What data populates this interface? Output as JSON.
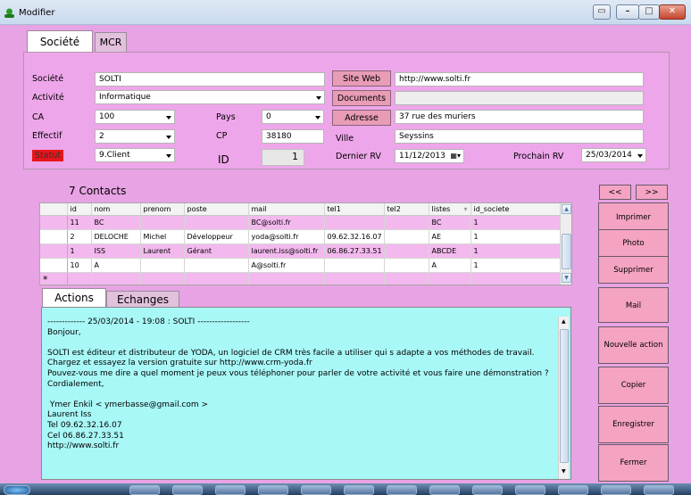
{
  "window": {
    "title": "Modifier"
  },
  "tabs_top": [
    "Société",
    "MCR"
  ],
  "societe": {
    "societe_label": "Société",
    "societe_value": "SOLTI",
    "activite_label": "Activité",
    "activite_value": "Informatique",
    "ca_label": "CA",
    "ca_value": "100",
    "effectif_label": "Effectif",
    "effectif_value": "2",
    "statut_label": "Statut",
    "statut_value": "9.Client",
    "pays_label": "Pays",
    "pays_value": "0",
    "cp_label": "CP",
    "cp_value": "38180",
    "id_label": "ID",
    "id_value": "1",
    "site_web_label": "Site Web",
    "site_web_value": "http://www.solti.fr",
    "documents_label": "Documents",
    "documents_value": "",
    "adresse_label": "Adresse",
    "adresse_value": "37 rue des muriers",
    "ville_label": "Ville",
    "ville_value": "Seyssins",
    "dernier_rv_label": "Dernier RV",
    "dernier_rv_value": "11/12/2013",
    "prochain_rv_label": "Prochain RV",
    "prochain_rv_value": "25/03/2014"
  },
  "contacts": {
    "title": "7 Contacts",
    "columns": [
      "id",
      "nom",
      "prenom",
      "poste",
      "mail",
      "tel1",
      "tel2",
      "listes",
      "id_societe"
    ],
    "rows": [
      [
        "11",
        "BC",
        "",
        "",
        "BC@solti.fr",
        "",
        "",
        "BC",
        "1"
      ],
      [
        "2",
        "DELOCHE",
        "Michel",
        "Développeur",
        "yoda@solti.fr",
        "09.62.32.16.07",
        "",
        "AE",
        "1"
      ],
      [
        "1",
        "ISS",
        "Laurent",
        "Gérant",
        "laurent.iss@solti.fr",
        "06.86.27.33.51",
        "",
        "ABCDE",
        "1"
      ],
      [
        "10",
        "A",
        "",
        "",
        "A@solti.fr",
        "",
        "",
        "A",
        "1"
      ]
    ],
    "new_row_marker": "*"
  },
  "tabs_mid": [
    "Actions",
    "Echanges"
  ],
  "actions_text": "------------- 25/03/2014 - 19:08 : SOLTI ------------------\nBonjour,\n\nSOLTI est éditeur et distributeur de YODA, un logiciel de CRM très facile a utiliser qui s adapte a vos méthodes de travail.\nChargez et essayez la version gratuite sur http://www.crm-yoda.fr\nPouvez-vous me dire a quel moment je peux vous téléphoner pour parler de votre activité et vous faire une démonstration ?\nCordialement,\n\n Ymer Enkil < ymerbasse@gmail.com >\nLaurent Iss\nTel 09.62.32.16.07\nCel 06.86.27.33.51\nhttp://www.solti.fr",
  "nav": {
    "prev": "<<",
    "next": ">>"
  },
  "buttons": [
    "Imprimer",
    "Photo",
    "Supprimer",
    "Mail",
    "Nouvelle action",
    "Copier",
    "Enregistrer",
    "Fermer"
  ]
}
